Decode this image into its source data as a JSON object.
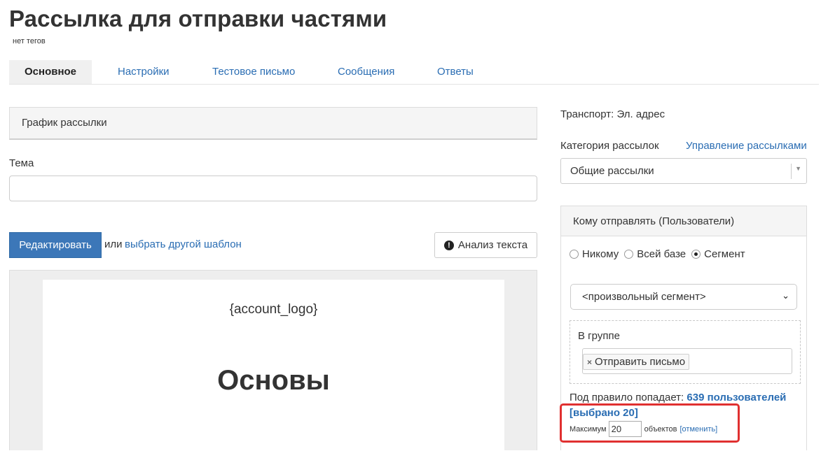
{
  "header": {
    "title": "Рассылка для отправки частями",
    "tags": "нет тегов"
  },
  "tabs": [
    {
      "label": "Основное",
      "active": true
    },
    {
      "label": "Настройки",
      "active": false
    },
    {
      "label": "Тестовое письмо",
      "active": false
    },
    {
      "label": "Сообщения",
      "active": false
    },
    {
      "label": "Ответы",
      "active": false
    }
  ],
  "main": {
    "schedule_title": "График рассылки",
    "subject_label": "Тема",
    "subject_value": "",
    "edit_button": "Редактировать",
    "or_text": "или",
    "template_link": "выбрать другой шаблон",
    "analyze_button": "Анализ текста",
    "analyze_icon": "exclamation-circle-icon",
    "preview": {
      "logo_placeholder": "{account_logo}",
      "heading": "Основы"
    }
  },
  "sidebar": {
    "transport": "Транспорт: Эл. адрес",
    "category_label": "Категория рассылок",
    "category_manage_link": "Управление рассылками",
    "category_value": "Общие рассылки",
    "recipients": {
      "title": "Кому отправлять (Пользователи)",
      "options": [
        {
          "label": "Никому",
          "checked": false
        },
        {
          "label": "Всей базе",
          "checked": false
        },
        {
          "label": "Сегмент",
          "checked": true
        }
      ],
      "segment_value": "<произвольный сегмент>",
      "group_label": "В группе",
      "group_tag": "Отправить письмо",
      "rule_prefix": "Под правило попадает:",
      "rule_count": "639 пользователей",
      "selected": "[выбрано 20]",
      "max_label": "Максимум",
      "max_value": "20",
      "objects_label": "объектов",
      "cancel_link": "[отменить]"
    }
  },
  "colors": {
    "accent": "#3c77b8",
    "link": "#2a6db3",
    "highlight": "#e03030"
  }
}
